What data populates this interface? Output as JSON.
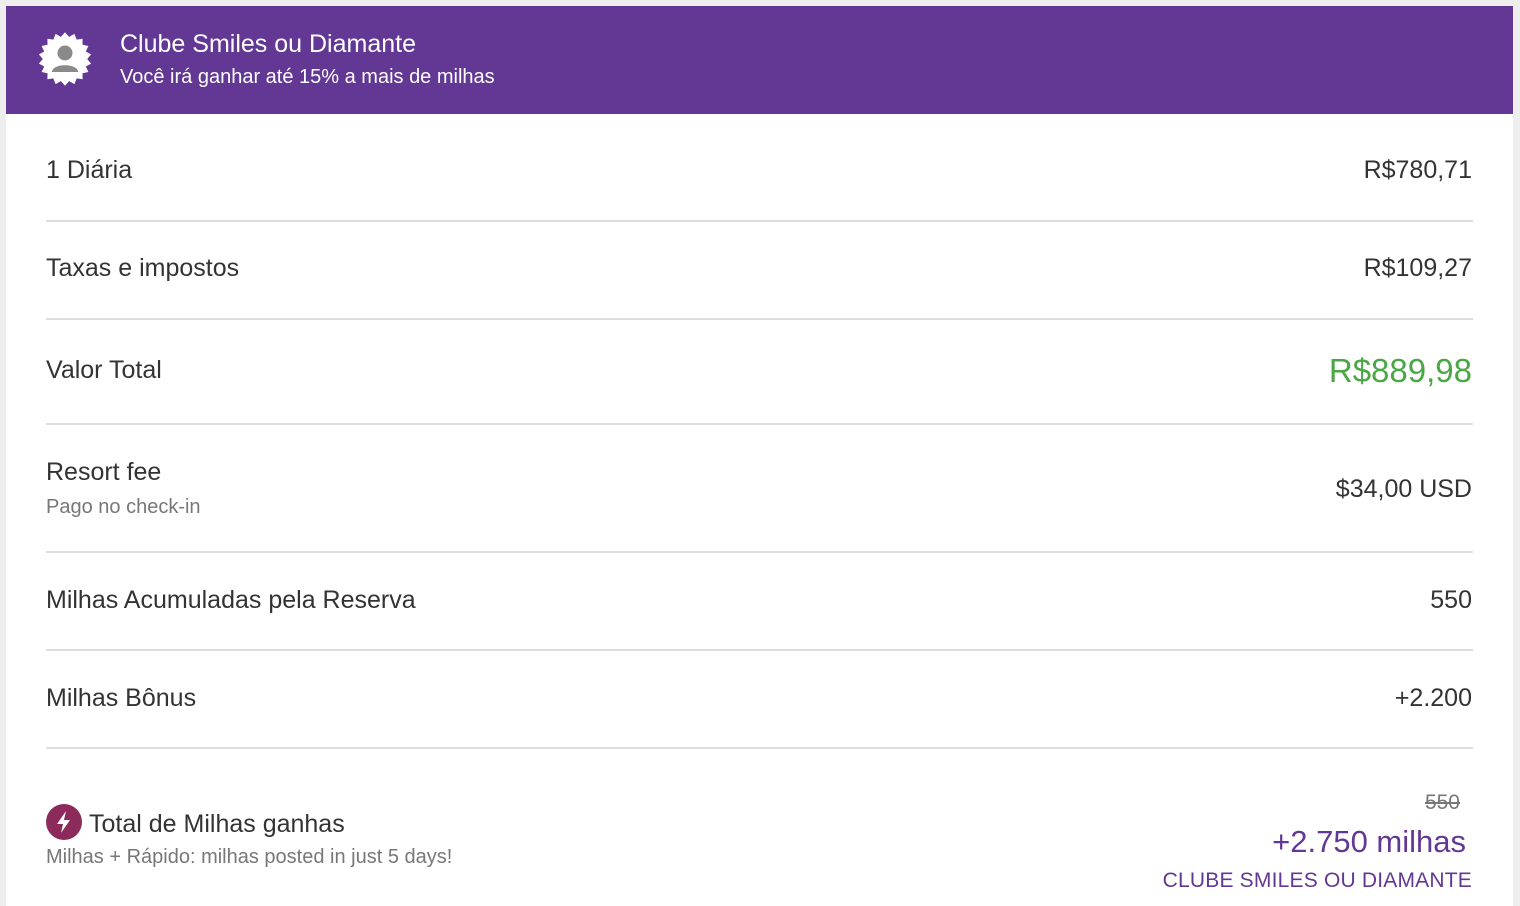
{
  "header": {
    "title": "Clube Smiles ou Diamante",
    "subtitle": "Você irá ganhar até 15% a mais de milhas",
    "icon": "user-avatar-badge-icon"
  },
  "rows": [
    {
      "label": "1 Diária",
      "value": "R$780,71"
    },
    {
      "label": "Taxas e impostos",
      "value": "R$109,27"
    },
    {
      "label": "Valor Total",
      "value": "R$889,98"
    },
    {
      "label": "Resort fee",
      "sublabel": "Pago no check-in",
      "value": "$34,00 USD"
    },
    {
      "label": "Milhas Acumuladas pela Reserva",
      "value": "550"
    },
    {
      "label": "Milhas Bônus",
      "value": "+2.200"
    }
  ],
  "summary": {
    "label": "Total de Milhas ganhas",
    "sublabel": "Milhas + Rápido: milhas posted in just 5 days!",
    "icon": "lightning-bolt-icon",
    "old_value": "550",
    "new_value": "+2.750 milhas",
    "club_label": "CLUBE SMILES OU DIAMANTE"
  },
  "colors": {
    "brand_purple": "#633794",
    "total_green": "#4aa844",
    "bolt_badge": "#8b2a5b"
  }
}
